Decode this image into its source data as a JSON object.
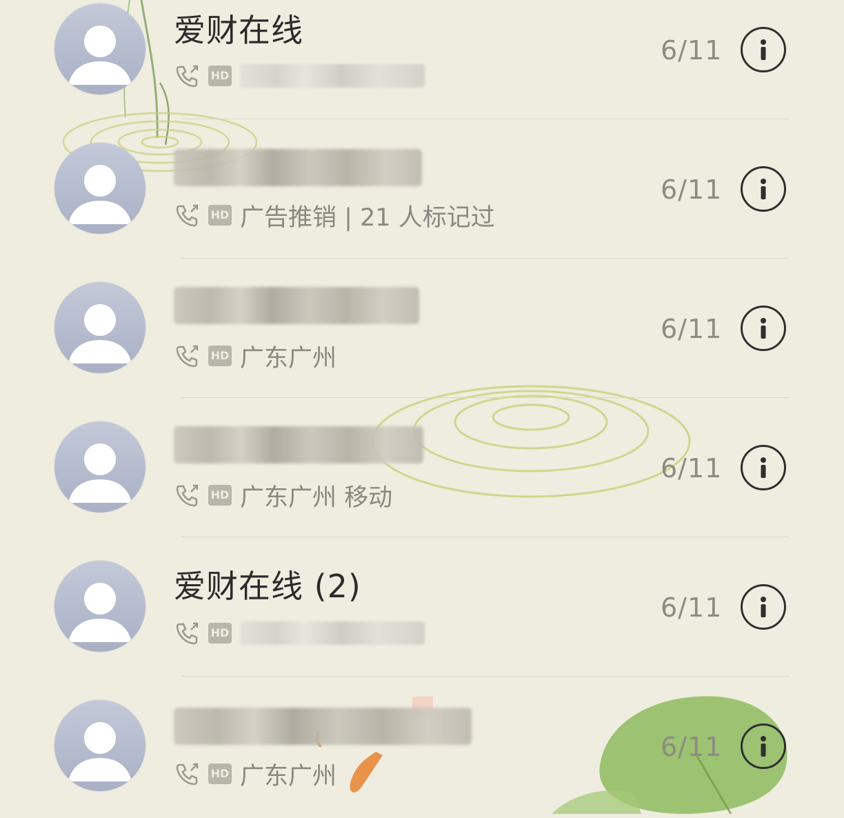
{
  "theme": {
    "background": "#efece0",
    "avatar_color": "#aab1c6",
    "name_color": "#2b2b2b",
    "secondary_color": "#8a8880"
  },
  "calls": [
    {
      "name": "爱财在线",
      "name_redacted": false,
      "call_icon": "outgoing-call-icon",
      "hd_label": "HD",
      "detail": "",
      "detail_redacted": true,
      "date": "6/11",
      "info_icon": "info-icon"
    },
    {
      "name": "",
      "name_redacted": true,
      "call_icon": "outgoing-call-icon",
      "hd_label": "HD",
      "detail": "广告推销 | 21 人标记过",
      "detail_redacted": false,
      "date": "6/11",
      "info_icon": "info-icon"
    },
    {
      "name": "",
      "name_redacted": true,
      "call_icon": "outgoing-call-icon",
      "hd_label": "HD",
      "detail": "广东广州",
      "detail_redacted": false,
      "date": "6/11",
      "info_icon": "info-icon"
    },
    {
      "name": "",
      "name_redacted": true,
      "call_icon": "outgoing-call-icon",
      "hd_label": "HD",
      "detail": "广东广州 移动",
      "detail_redacted": false,
      "date": "6/11",
      "info_icon": "info-icon"
    },
    {
      "name": "爱财在线 (2)",
      "name_redacted": false,
      "call_icon": "outgoing-call-icon",
      "hd_label": "HD",
      "detail": "",
      "detail_redacted": true,
      "date": "6/11",
      "info_icon": "info-icon"
    },
    {
      "name": "",
      "name_redacted": true,
      "call_icon": "outgoing-call-icon",
      "hd_label": "HD",
      "detail": "广东广州",
      "detail_redacted": false,
      "date": "6/11",
      "info_icon": "info-icon"
    }
  ]
}
